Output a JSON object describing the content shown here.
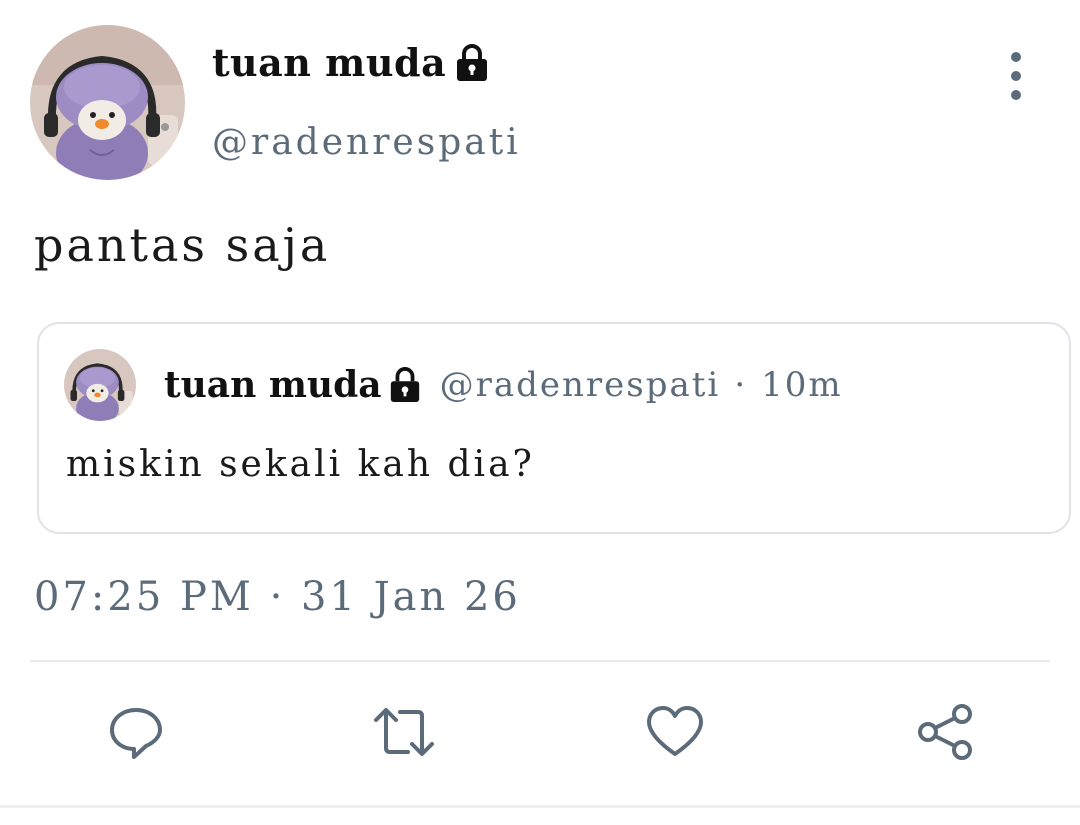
{
  "author": {
    "display_name": "tuan muda",
    "handle": "@radenrespati",
    "avatar_icon": "purple-hooded-duck-avatar",
    "locked_icon": "lock-icon"
  },
  "tweet": {
    "text": "pantas saja",
    "timestamp": "07:25 PM · 31 Jan 26"
  },
  "quoted_tweet": {
    "display_name": "tuan muda",
    "handle": "@radenrespati",
    "separator": "·",
    "relative_time": "10m",
    "text": "miskin sekali kah dia?"
  },
  "actions": [
    {
      "name": "reply",
      "icon": "reply-icon"
    },
    {
      "name": "retweet",
      "icon": "retweet-icon"
    },
    {
      "name": "like",
      "icon": "heart-icon"
    },
    {
      "name": "share",
      "icon": "share-icon"
    }
  ],
  "colors": {
    "text_primary": "#1a1a1a",
    "text_secondary": "#5c6b7a",
    "border": "#dfe3e8",
    "avatar_purple": "#8f7db8"
  }
}
